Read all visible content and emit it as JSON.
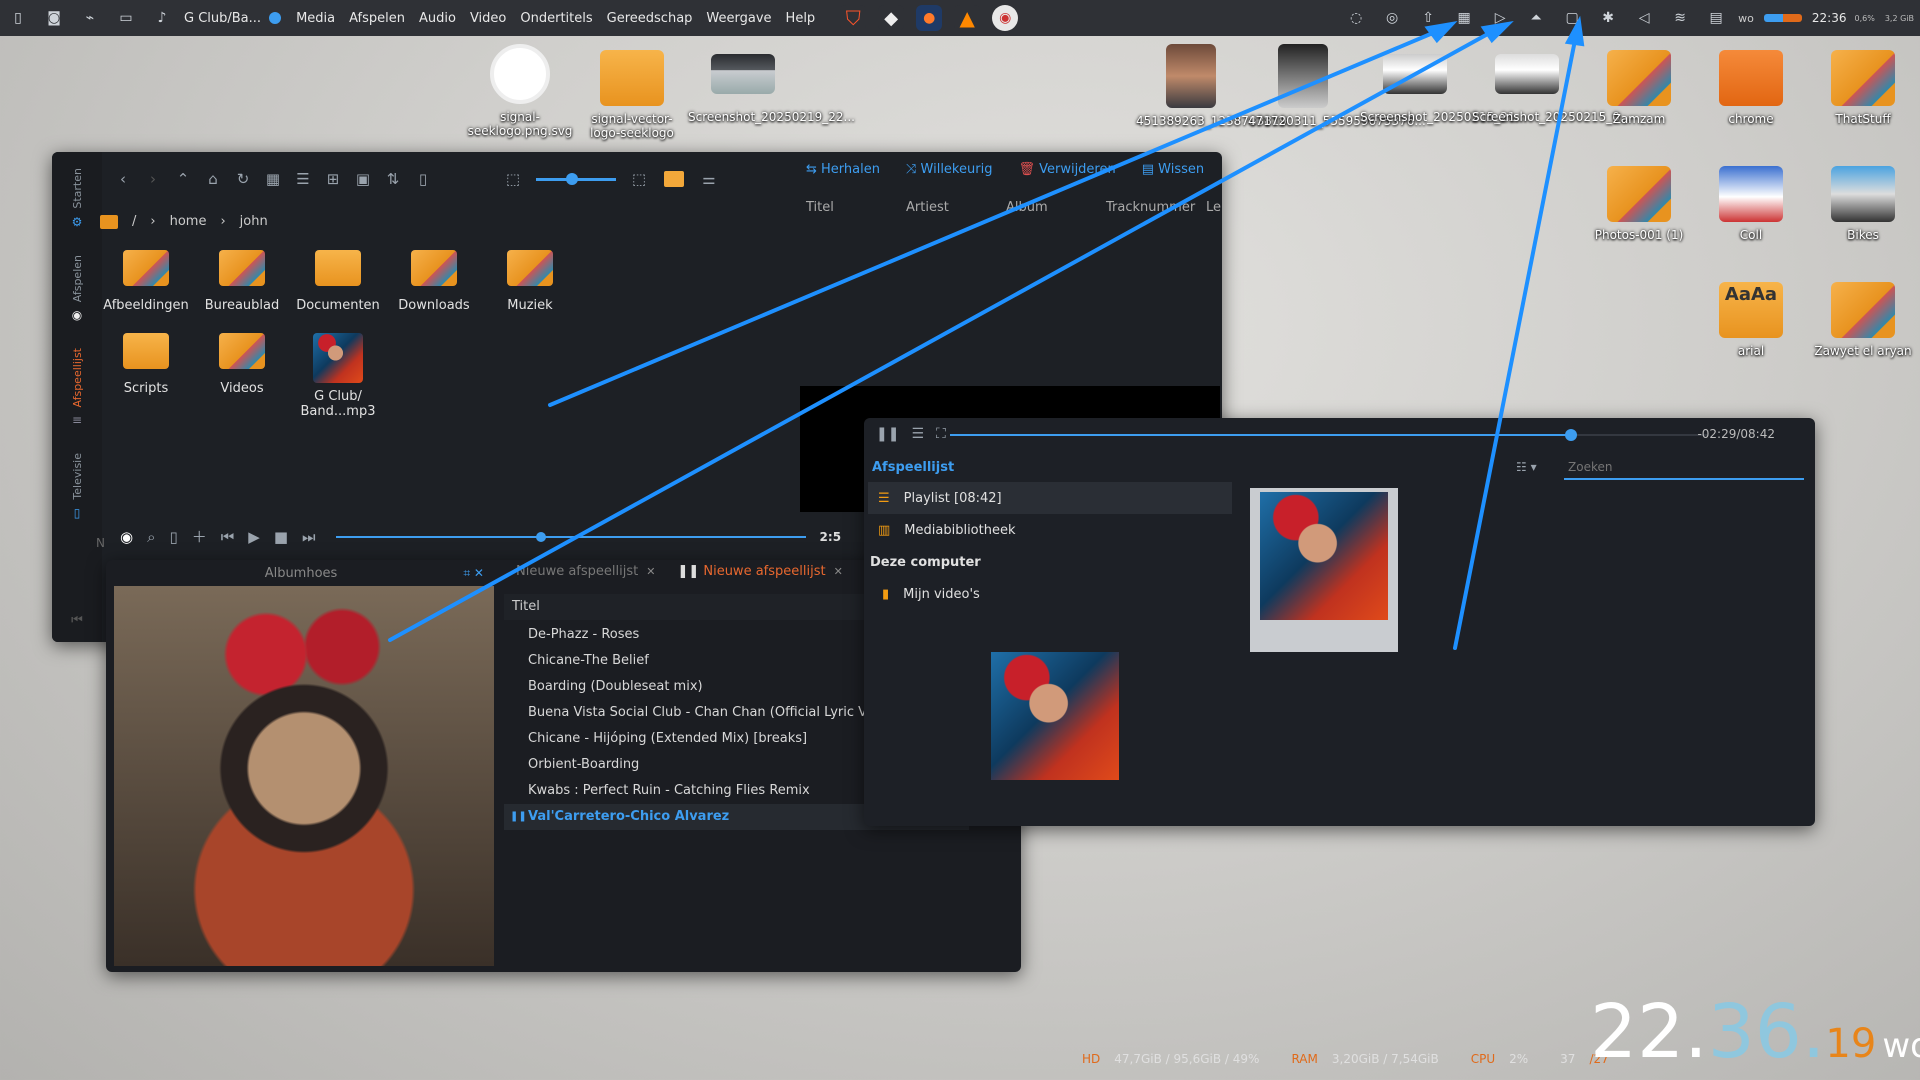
{
  "topbar": {
    "app_title": "G Club/Ba...",
    "menus": [
      "Media",
      "Afspelen",
      "Audio",
      "Video",
      "Ondertitels",
      "Gereedschap",
      "Weergave",
      "Help"
    ],
    "clock": "22:36",
    "day_short": "wo",
    "sys_mini": [
      "0,6%",
      "3,2 GiB"
    ]
  },
  "desktop": {
    "icons": [
      {
        "label": "signal-seeklogo.png.svg"
      },
      {
        "label": "signal-vector-logo-seeklogo"
      },
      {
        "label": "Screenshot_20250219_22..."
      },
      {
        "label": "451389263_1238783819..."
      },
      {
        "label": "471720311_555959675376..."
      },
      {
        "label": "Screenshot_20250215_21..."
      },
      {
        "label": "Screenshot_20250215_0..."
      },
      {
        "label": "Zamzam"
      },
      {
        "label": "chrome"
      },
      {
        "label": "ThatStuff"
      },
      {
        "label": "Photos-001 (1)"
      },
      {
        "label": "Coll"
      },
      {
        "label": "Bikes"
      },
      {
        "label": "arial"
      },
      {
        "label": "Zawyet el aryan"
      }
    ]
  },
  "filemanager": {
    "sidetabs": [
      "Starten",
      "Afspelen",
      "Afspeellijst",
      "Televisie"
    ],
    "path": [
      "home",
      "john"
    ],
    "path_root": "/",
    "items": [
      "Afbeeldingen",
      "Bureaublad",
      "Documenten",
      "Downloads",
      "Muziek",
      "Scripts",
      "Videos",
      "G Club/ Band...mp3"
    ],
    "playlist_actions": [
      "Herhalen",
      "Willekeurig",
      "Verwijderen",
      "Wissen"
    ],
    "columns": [
      "Titel",
      "Artiest",
      "Album",
      "Tracknummer",
      "Le"
    ],
    "time": "2:5",
    "letter": "N"
  },
  "player": {
    "albumhoes": "Albumhoes",
    "tabs": [
      {
        "label": "Nieuwe afspeellijst"
      },
      {
        "label": "Nieuwe afspeellijst"
      }
    ],
    "col_title": "Titel",
    "tracks": [
      "De-Phazz - Roses",
      "Chicane-The Belief",
      "Boarding (Doubleseat mix)",
      "Buena Vista Social Club - Chan Chan (Official Lyric Video)",
      "Chicane - Hijóping (Extended Mix) [breaks]",
      "Orbient-Boarding",
      "Kwabs  :  Perfect Ruin - Catching Flies Remix",
      "Val'Carretero-Chico Alvarez"
    ]
  },
  "vlc": {
    "time_remaining": "-02:29/08:42",
    "section": "Afspeellijst",
    "search_placeholder": "Zoeken",
    "playlist": "Playlist [08:42]",
    "media_library": "Mediabibliotheek",
    "this_computer": "Deze computer",
    "my_videos": "Mijn video's",
    "progress": 0.82
  },
  "conky": {
    "hours": "22",
    "minutes": "36",
    "seconds": "19",
    "day": "wo",
    "hd_label": "HD",
    "hd_value": "47,7GiB / 95,6GiB / 49%",
    "ram_label": "RAM",
    "ram_value": "3,20GiB / 7,54GiB",
    "cpu_label": "CPU",
    "cpu_value": "2%",
    "temp1": "37",
    "temp2": "/27"
  },
  "colors": {
    "accent": "#3d9df0",
    "active_tab": "#e8682f",
    "clock_cyan": "#8fc7de",
    "clock_orange": "#e8851a"
  }
}
